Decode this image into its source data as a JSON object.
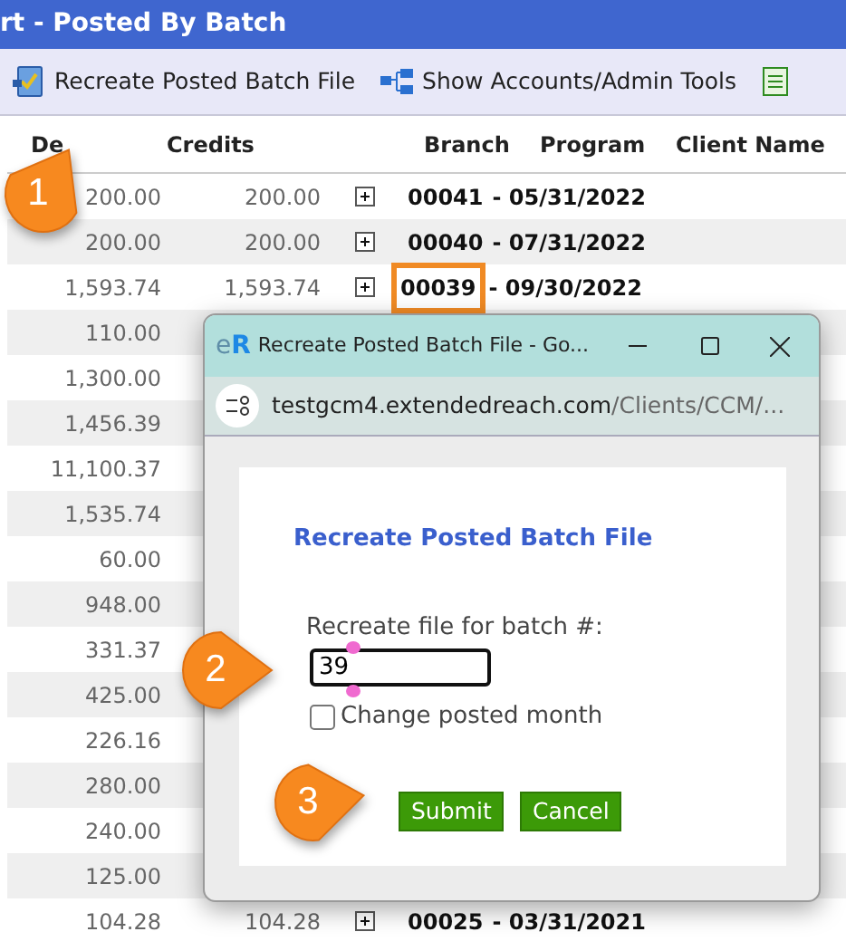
{
  "header": {
    "title": "rt - Posted By Batch"
  },
  "toolbar": [
    {
      "kind": "recreate",
      "label": "Recreate Posted Batch File"
    },
    {
      "kind": "tree",
      "label": "Show Accounts/Admin Tools"
    },
    {
      "kind": "sheet"
    }
  ],
  "table": {
    "columns": [
      "De",
      "Credits",
      "Branch",
      "Program",
      "Client Name"
    ],
    "rows": [
      {
        "debit": "200.00",
        "credit": "200.00",
        "batch_number": "00041",
        "batch_rest": "- 05/31/2022",
        "highlighted": false
      },
      {
        "debit": "200.00",
        "credit": "200.00",
        "batch_number": "00040",
        "batch_rest": "- 07/31/2022",
        "highlighted": false
      },
      {
        "debit": "1,593.74",
        "credit": "1,593.74",
        "batch_number": "00039",
        "batch_rest": "- 09/30/2022",
        "highlighted": true
      },
      {
        "debit": "110.00"
      },
      {
        "debit": "1,300.00"
      },
      {
        "debit": "1,456.39"
      },
      {
        "debit": "11,100.37"
      },
      {
        "debit": "1,535.74"
      },
      {
        "debit": "60.00"
      },
      {
        "debit": "948.00"
      },
      {
        "debit": "331.37"
      },
      {
        "debit": "425.00"
      },
      {
        "debit": "226.16"
      },
      {
        "debit": "280.00"
      },
      {
        "debit": "240.00"
      },
      {
        "debit": "125.00"
      },
      {
        "debit": "104.28",
        "credit": "104.28",
        "batch_number": "00025",
        "batch_rest": "- 03/31/2021",
        "highlighted": false
      }
    ]
  },
  "dialog": {
    "logo": "eR",
    "title": "Recreate Posted Batch File - Go...",
    "url_host": "testgcm4.extendedreach.com",
    "url_path": "/Clients/CCM/...",
    "heading": "Recreate Posted Batch File",
    "field_label": "Recreate file for batch #:",
    "field_value": "39",
    "checkbox": {
      "label": "Change posted month",
      "checked": false
    },
    "buttons": [
      "Submit",
      "Cancel"
    ]
  },
  "callouts": [
    "1",
    "2",
    "3"
  ]
}
